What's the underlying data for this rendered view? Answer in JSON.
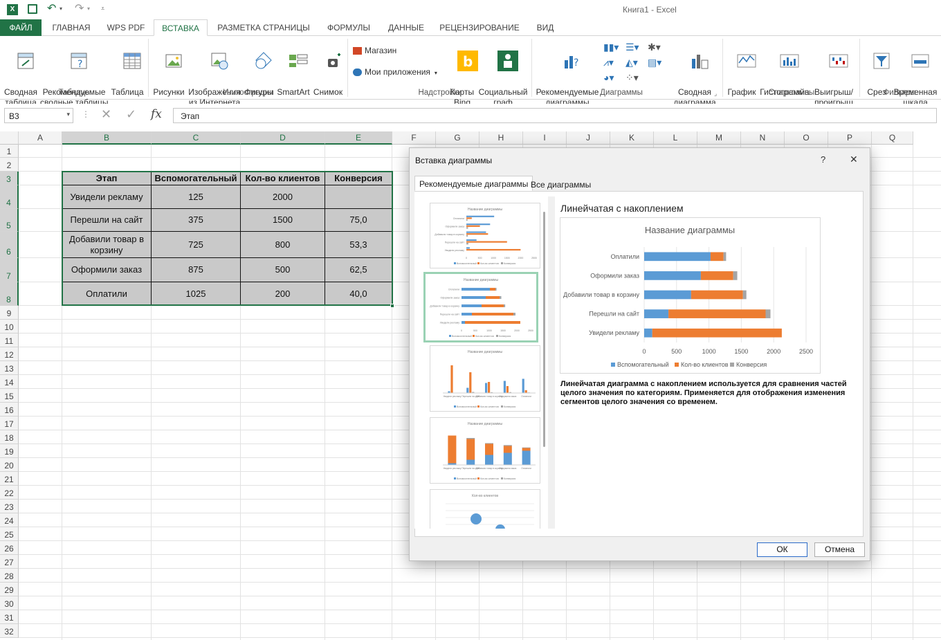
{
  "window": {
    "title": "Книга1 - Excel"
  },
  "colors": {
    "excel_green": "#217346",
    "blue": "#5b9bd5",
    "orange": "#ed7d31",
    "gray": "#a5a5a5"
  },
  "tabs": [
    {
      "label": "ФАЙЛ"
    },
    {
      "label": "ГЛАВНАЯ"
    },
    {
      "label": "WPS PDF"
    },
    {
      "label": "ВСТАВКА"
    },
    {
      "label": "РАЗМЕТКА СТРАНИЦЫ"
    },
    {
      "label": "ФОРМУЛЫ"
    },
    {
      "label": "ДАННЫЕ"
    },
    {
      "label": "РЕЦЕНЗИРОВАНИЕ"
    },
    {
      "label": "ВИД"
    }
  ],
  "ribbon": {
    "pivot": "Сводная\nтаблица",
    "rec_pivot": "Рекомендуемые\nсводные таблицы",
    "table": "Таблица",
    "pictures": "Рисунки",
    "online_pictures": "Изображения\nиз Интернета",
    "shapes": "Фигуры",
    "smartart": "SmartArt",
    "screenshot": "Снимок",
    "store": "Магазин",
    "my_apps": "Мои приложения",
    "bing_maps": "Карты\nBing",
    "people_graph": "Социальный\nграф",
    "rec_charts": "Рекомендуемые\nдиаграммы",
    "pivot_chart": "Сводная\nдиаграмма",
    "line": "График",
    "column": "Гистограмма",
    "winloss": "Выигрыш/\nпроигрыш",
    "slicer": "Срез",
    "timeline": "Временная\nшкала",
    "groups": {
      "tables": "Таблицы",
      "illustrations": "Иллюстрации",
      "addins": "Надстройки",
      "charts": "Диаграммы",
      "sparklines": "Спарклайны",
      "filters": "Фильтры"
    }
  },
  "formula_bar": {
    "name_box": "B3",
    "fx": "fx",
    "content": "Этап"
  },
  "columns": [
    "A",
    "B",
    "C",
    "D",
    "E",
    "F",
    "G",
    "H",
    "I",
    "J",
    "K",
    "L",
    "M",
    "N",
    "O",
    "P",
    "Q"
  ],
  "rows": [
    "1",
    "2",
    "3",
    "4",
    "5",
    "6",
    "7",
    "8",
    "9",
    "10",
    "11",
    "12",
    "13",
    "14",
    "15",
    "16",
    "17",
    "18",
    "19",
    "20",
    "21",
    "22",
    "23",
    "24",
    "25",
    "26",
    "27",
    "28",
    "29",
    "30",
    "31",
    "32"
  ],
  "table": {
    "headers": [
      "Этап",
      "Вспомогательный",
      "Кол-во клиентов",
      "Конверсия"
    ],
    "rows": [
      [
        "Увидели рекламу",
        "125",
        "2000",
        ""
      ],
      [
        "Перешли на сайт",
        "375",
        "1500",
        "75,0"
      ],
      [
        "Добавили товар в корзину",
        "725",
        "800",
        "53,3"
      ],
      [
        "Оформили заказ",
        "875",
        "500",
        "62,5"
      ],
      [
        "Оплатили",
        "1025",
        "200",
        "40,0"
      ]
    ]
  },
  "dialog": {
    "title": "Вставка диаграммы",
    "help": "?",
    "close": "✕",
    "tab_recommended": "Рекомендуемые диаграммы",
    "tab_all": "Все диаграммы",
    "preview_title": "Линейчатая с накоплением",
    "description": "Линейчатая диаграмма с накоплением используется для сравнения частей целого значения по категориям. Применяется для отображения изменения сегментов целого значения со временем.",
    "ok": "ОК",
    "cancel": "Отмена"
  },
  "chart_data": {
    "type": "bar",
    "title": "Название диаграммы",
    "categories": [
      "Оплатили",
      "Оформили заказ",
      "Добавили товар в корзину",
      "Перешли на сайт",
      "Увидели рекламу"
    ],
    "series": [
      {
        "name": "Вспомогательный",
        "values": [
          1025,
          875,
          725,
          375,
          125
        ]
      },
      {
        "name": "Кол-во клиентов",
        "values": [
          200,
          500,
          800,
          1500,
          2000
        ]
      },
      {
        "name": "Конверсия",
        "values": [
          40,
          62.5,
          53.3,
          75,
          0
        ]
      }
    ],
    "xticks": [
      "0",
      "500",
      "1000",
      "1500",
      "2000",
      "2500"
    ],
    "xlim": [
      0,
      2500
    ],
    "stacked": true,
    "legend": "bottom"
  }
}
